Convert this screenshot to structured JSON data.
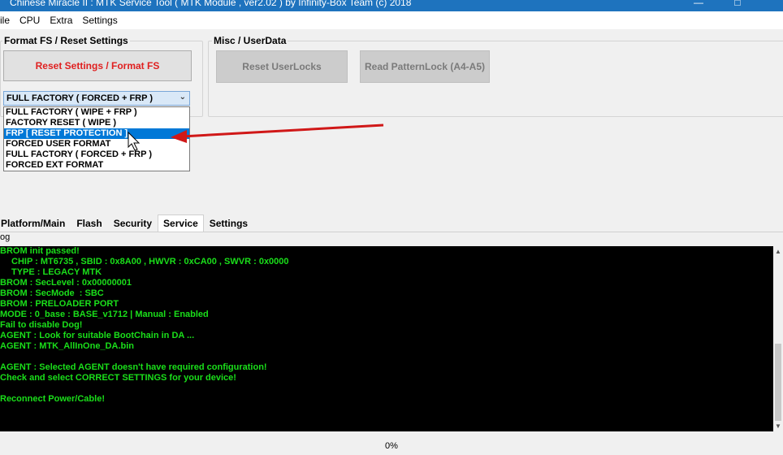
{
  "window": {
    "title": "Chinese Miracle II : MTK Service Tool ( MTK Module , ver2.02 ) by Infinity-Box Team (c) 2018",
    "minimize_glyph": "—",
    "restore_glyph": "□"
  },
  "menu": [
    "ile",
    "CPU",
    "Extra",
    "Settings"
  ],
  "format_group": {
    "title": "Format FS / Reset Settings",
    "reset_button": "Reset Settings / Format FS",
    "combo_value": "FULL FACTORY ( FORCED + FRP )",
    "options": [
      "FULL FACTORY ( WIPE + FRP )",
      "FACTORY RESET ( WIPE )",
      "FRP [ RESET PROTECTION ]",
      "FORCED USER FORMAT",
      "FULL FACTORY ( FORCED + FRP )",
      "FORCED EXT FORMAT"
    ],
    "selected_index": 2
  },
  "misc_group": {
    "title": "Misc  /  UserData",
    "reset_userlocks": "Reset UserLocks",
    "read_patternlock": "Read PatternLock (A4-A5)"
  },
  "tabs": [
    "Platform/Main",
    "Flash",
    "Security",
    "Service",
    "Settings"
  ],
  "active_tab": 3,
  "log_label": "og",
  "log_lines": [
    {
      "text": "BROM init passed!",
      "indent": false
    },
    {
      "text": "CHIP : MT6735 , SBID : 0x8A00 , HWVR : 0xCA00 , SWVR : 0x0000",
      "indent": true
    },
    {
      "text": "TYPE : LEGACY MTK",
      "indent": true
    },
    {
      "text": "BROM : SecLevel : 0x00000001",
      "indent": false
    },
    {
      "text": "BROM : SecMode  : SBC",
      "indent": false
    },
    {
      "text": "BROM : PRELOADER PORT",
      "indent": false
    },
    {
      "text": "MODE : 0_base : BASE_v1712 | Manual : Enabled",
      "indent": false
    },
    {
      "text": "Fail to disable Dog!",
      "indent": false
    },
    {
      "text": "AGENT : Look for suitable BootChain in DA ...",
      "indent": false
    },
    {
      "text": "AGENT : MTK_AllInOne_DA.bin",
      "indent": false
    },
    {
      "text": "",
      "indent": false
    },
    {
      "text": "AGENT : Selected AGENT doesn't have required configuration!",
      "indent": false
    },
    {
      "text": "Check and select CORRECT SETTINGS for your device!",
      "indent": false
    },
    {
      "text": "",
      "indent": false
    },
    {
      "text": "Reconnect Power/Cable!",
      "indent": false
    }
  ],
  "status": {
    "progress_text": "0%",
    "progress": 0
  },
  "colors": {
    "titlebar": "#1e73be",
    "log_bg": "#000000",
    "log_text": "#1adf1a",
    "primary_button_text": "#e02020",
    "selection": "#0078d7",
    "annotation_arrow": "#d01818"
  }
}
